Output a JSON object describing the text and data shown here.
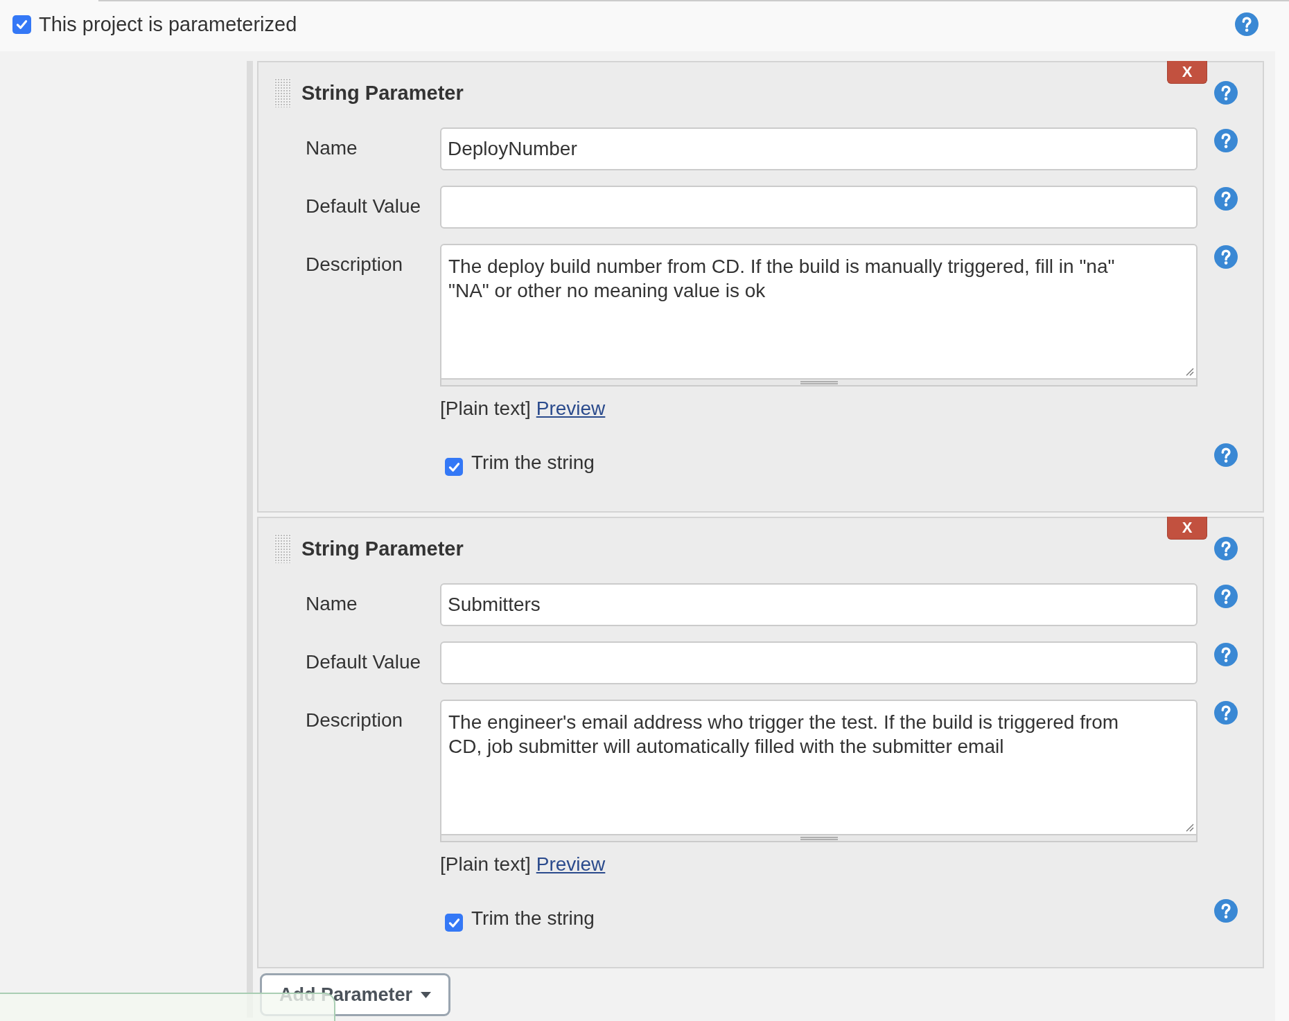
{
  "project_option": {
    "label": "This project is parameterized",
    "checked": true
  },
  "parameters": [
    {
      "title": "String Parameter",
      "delete_label": "X",
      "fields": [
        {
          "kind": "input",
          "label": "Name",
          "value": "DeployNumber"
        },
        {
          "kind": "input",
          "label": "Default Value"
        },
        {
          "kind": "textarea",
          "label": "Description",
          "value": "The deploy build number from CD. If the build is manually triggered, fill in \"na\" \"NA\" or other no meaning value is ok"
        }
      ],
      "format_note": "[Plain text]",
      "preview_link": "Preview",
      "trim": {
        "label": "Trim the string",
        "checked": true
      }
    },
    {
      "title": "String Parameter",
      "delete_label": "X",
      "fields": [
        {
          "kind": "input",
          "label": "Name",
          "value": "Submitters"
        },
        {
          "kind": "input",
          "label": "Default Value"
        },
        {
          "kind": "textarea",
          "label": "Description",
          "value": "The engineer's email address who trigger the test. If the build is triggered from CD, job submitter will automatically filled with the submitter email"
        }
      ],
      "format_note": "[Plain text]",
      "preview_link": "Preview",
      "trim": {
        "label": "Trim the string",
        "checked": true
      }
    }
  ],
  "add_button": {
    "label": "Add Parameter"
  }
}
